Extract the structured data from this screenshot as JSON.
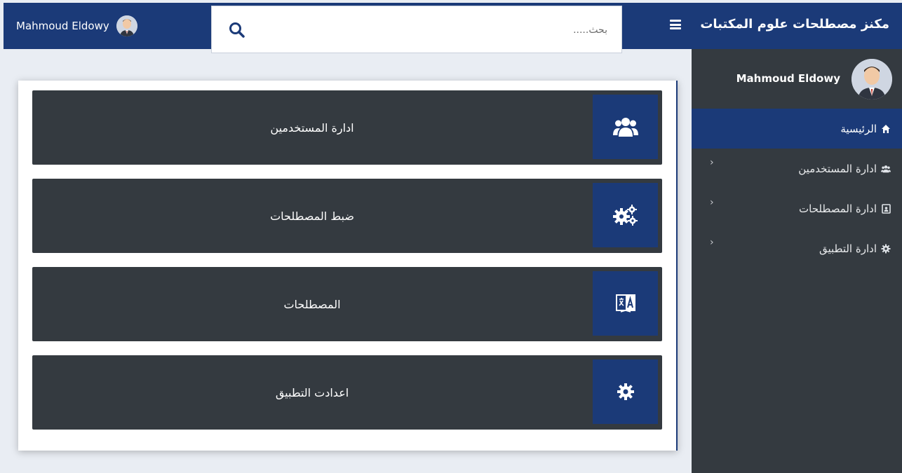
{
  "header": {
    "brand_title": "مكنز مصطلحات علوم المكتبات",
    "user_name": "Mahmoud Eldowy",
    "search_placeholder": "بحث.....",
    "hamburger_icon": "hamburger-icon",
    "search_icon": "search-icon"
  },
  "sidebar": {
    "user_name": "Mahmoud Eldowy",
    "items": [
      {
        "label": "الرئيسية",
        "icon": "home-icon",
        "active": true
      },
      {
        "label": "ادارة المستخدمين",
        "icon": "users-icon",
        "active": false
      },
      {
        "label": "ادارة المصطلحات",
        "icon": "contact-card-icon",
        "active": false
      },
      {
        "label": "ادارة التطبيق",
        "icon": "gear-icon",
        "active": false
      }
    ]
  },
  "cards": [
    {
      "label": "ادارة المستخدمين",
      "icon": "users-icon"
    },
    {
      "label": "ضبط المصطلحات",
      "icon": "gears-icon"
    },
    {
      "label": "المصطلحات",
      "icon": "translate-icon"
    },
    {
      "label": "اعدادت التطبيق",
      "icon": "gear-icon"
    }
  ],
  "colors": {
    "primary": "#1b3a78",
    "dark": "#343a40",
    "background": "#e9edf3"
  }
}
